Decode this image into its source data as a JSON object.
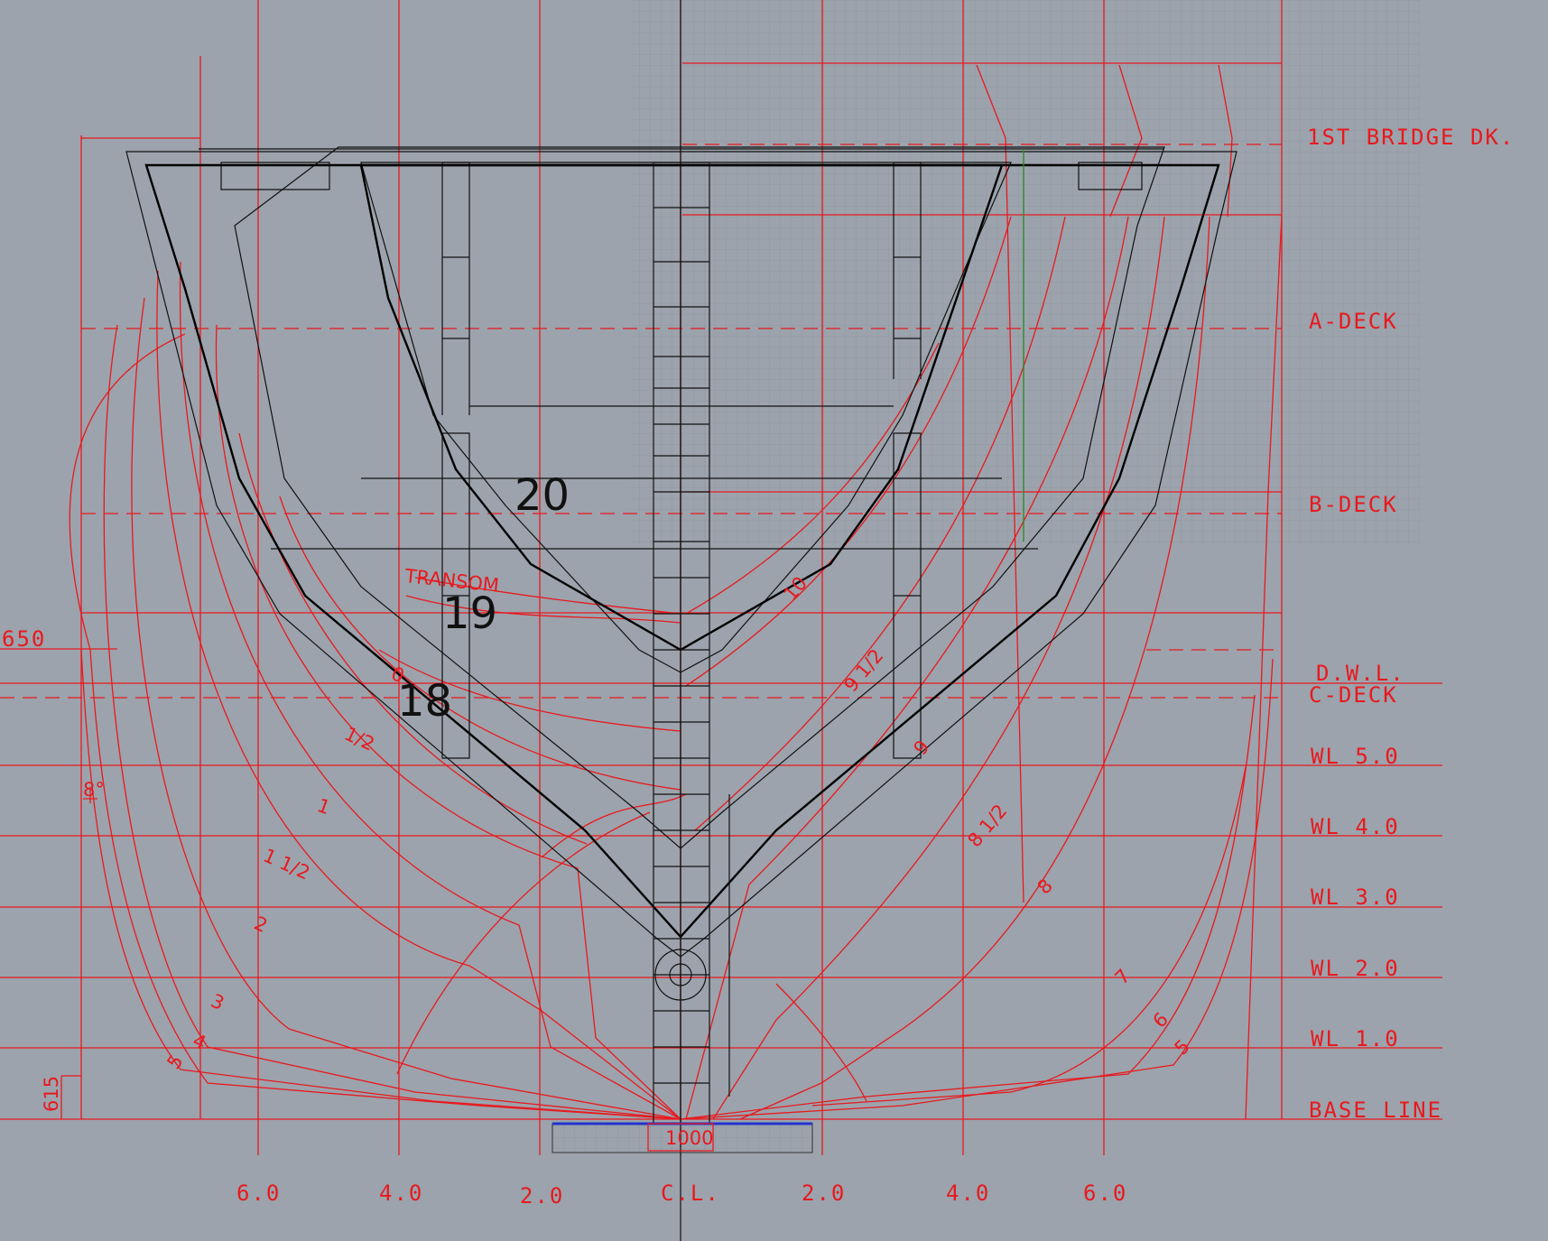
{
  "deck_labels": {
    "first_bridge": "1ST BRIDGE DK.",
    "a_deck": "A-DECK",
    "b_deck": "B-DECK",
    "dwl": "D.W.L.",
    "c_deck": "C-DECK",
    "wl5": "WL 5.0",
    "wl4": "WL 4.0",
    "wl3": "WL 3.0",
    "wl2": "WL 2.0",
    "wl1": "WL 1.0",
    "base": "BASE LINE"
  },
  "half_breadth_labels": {
    "l6": "6.0",
    "l4": "4.0",
    "l2": "2.0",
    "cl": "C.L.",
    "r2": "2.0",
    "r4": "4.0",
    "r6": "6.0"
  },
  "frames": {
    "f18": "18",
    "f19": "19",
    "f20": "20"
  },
  "stations": {
    "transom": "TRANSOM",
    "s0": "0",
    "s05": "1/2",
    "s1": "1",
    "s15": "1 1/2",
    "s2": "2",
    "s3": "3",
    "s4": "4",
    "s5": "5",
    "s10": "10",
    "s95": "9 1/2",
    "s9": "9",
    "s85": "8 1/2",
    "s8": "8",
    "s7": "7",
    "s6": "6",
    "s5r": "5"
  },
  "dimensions": {
    "d650": "650",
    "d615": "615",
    "d1000": "1000",
    "angle": "8°"
  },
  "colors": {
    "background": "#9ca3ac",
    "lines": "#e8191e",
    "structure": "#111111",
    "keel": "#2233cc",
    "marker": "#2e8b2e"
  }
}
